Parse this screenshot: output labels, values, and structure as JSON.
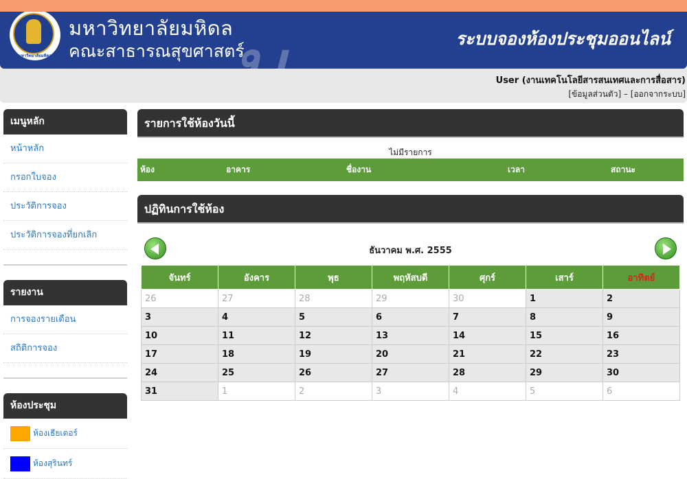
{
  "header": {
    "university_name": "มหาวิทยาลัยมหิดล",
    "faculty_name": "คณะสาธารณสุขศาสตร์",
    "system_title": "ระบบจองห้องประชุมออนไลน์",
    "logo_text_top": "มหิดล",
    "logo_text_bottom": "มหาวิทยาลัยมหิดล"
  },
  "user": {
    "name_line": "User (งานเทคโนโลยีสารสนเทศและการสื่อสาร)",
    "profile_link": "[ข้อมูลส่วนตัว]",
    "separator": " – ",
    "logout_link": "[ออกจากระบบ]"
  },
  "sidebar": {
    "main_menu": {
      "title": "เมนูหลัก",
      "items": [
        "หน้าหลัก",
        "กรอกใบจอง",
        "ประวัติการจอง",
        "ประวัติการจองที่ยกเลิก"
      ]
    },
    "reports": {
      "title": "รายงาน",
      "items": [
        "การจองรายเดือน",
        "สถิติการจอง"
      ]
    },
    "rooms": {
      "title": "ห้องประชุม",
      "items": [
        {
          "label": "ห้องเธียเตอร์",
          "color": "#ffa500"
        },
        {
          "label": "ห้องสุรินทร์",
          "color": "#0000ff"
        }
      ]
    }
  },
  "today": {
    "title": "รายการใช้ห้องวันนี้",
    "empty_text": "ไม่มีรายการ",
    "columns": [
      "ห้อง",
      "อาคาร",
      "ชื่องาน",
      "เวลา",
      "สถานะ"
    ]
  },
  "calendar": {
    "title": "ปฏิทินการใช้ห้อง",
    "month_label": "ธันวาคม  พ.ศ. 2555",
    "weekdays": [
      "จันทร์",
      "อังคาร",
      "พุธ",
      "พฤหัสบดี",
      "ศุกร์",
      "เสาร์",
      "อาทิตย์"
    ],
    "weeks": [
      [
        "26",
        "27",
        "28",
        "29",
        "30",
        "1",
        "2"
      ],
      [
        "3",
        "4",
        "5",
        "6",
        "7",
        "8",
        "9"
      ],
      [
        "10",
        "11",
        "12",
        "13",
        "14",
        "15",
        "16"
      ],
      [
        "17",
        "18",
        "19",
        "20",
        "21",
        "22",
        "23"
      ],
      [
        "24",
        "25",
        "26",
        "27",
        "28",
        "29",
        "30"
      ],
      [
        "31",
        "1",
        "2",
        "3",
        "4",
        "5",
        "6"
      ]
    ],
    "other_month": [
      [
        true,
        true,
        true,
        true,
        true,
        false,
        false
      ],
      [
        false,
        false,
        false,
        false,
        false,
        false,
        false
      ],
      [
        false,
        false,
        false,
        false,
        false,
        false,
        false
      ],
      [
        false,
        false,
        false,
        false,
        false,
        false,
        false
      ],
      [
        false,
        false,
        false,
        false,
        false,
        false,
        false
      ],
      [
        false,
        true,
        true,
        true,
        true,
        true,
        true
      ]
    ],
    "colors": {
      "header_green": "#5c9d3a",
      "sunday_red": "#e02020"
    }
  }
}
